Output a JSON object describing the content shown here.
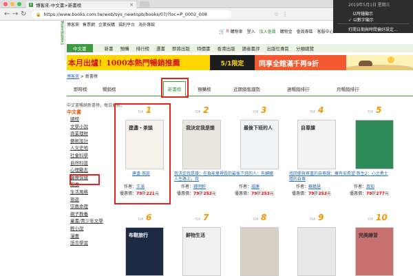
{
  "browser": {
    "tab_title": "博客來-中文書>新書榜",
    "favicon_text": "b",
    "url": "https://www.books.com.tw/web/sys_newtopb/books/07/?loc=P_0002_008",
    "tab_close": "×"
  },
  "menubar_popup": {
    "datetime": "2019年5月1日 星期三",
    "opt1": "以時鐘顯示",
    "opt2": "✓ 以數字顯示",
    "opt3": "打開日期與時間偏好設定..."
  },
  "site": {
    "side_logo": "博客來網路書店",
    "top_links": [
      "博客來",
      "售票網",
      "企業採購",
      "福利平台",
      "海外專館"
    ],
    "cart_count": "0",
    "cart_label": "購物車",
    "login": "登入",
    "join": "加入會員",
    "links": [
      "購物金",
      "會員專區",
      "客服中心"
    ],
    "green_menu": [
      "中文書",
      "新書",
      "預購",
      "排行榜",
      "選書",
      "即將出版",
      "特價書",
      "香港出版",
      "讀者書評",
      "出版社專區",
      "分類總覽"
    ],
    "banner_text": "本月出爐！1000本熱門暢銷推薦",
    "banner_mid": "5/1限定",
    "banner_right": "同享全館滿千再9折",
    "breadcrumb_home": "博客來",
    "breadcrumb_sep": " > ",
    "breadcrumb_current": "新書榜",
    "subnav": [
      "即時榜",
      "暢銷榜",
      "新書榜",
      "預購榜",
      "近期銷售趨勢",
      "週暢銷排行",
      "月暢銷排行"
    ],
    "description": "中文書暢銷新書榜，每日更新。",
    "sidebar_title": "中文書",
    "sidebar": [
      "總榜",
      "文學小說",
      "商業理財",
      "藝術設計",
      "人文史地",
      "社會科學",
      "自然科普",
      "心理勵志",
      "醫療保健",
      "飲食",
      "生活風格",
      "旅遊",
      "宗教命理",
      "親子教養",
      "童書/青少年文學",
      "輕小說",
      "漫畫",
      "語言學習"
    ]
  },
  "products": [
    {
      "rank": "1",
      "title": "建盞‧茶談",
      "author": "王滿",
      "price_label": "優惠價：",
      "discount": "79",
      "discount_unit": "折",
      "price": "221",
      "price_unit": "元",
      "cover_title": "建盞・茶談"
    },
    {
      "rank": "2",
      "title": "我決定我是誰：在負能量裡長的人生路上，我",
      "author": "鍾明軒",
      "price_label": "優惠價：",
      "discount": "79",
      "discount_unit": "折",
      "price": "253",
      "price_unit": "元",
      "cover_title": "我決定我是誰"
    },
    {
      "rank": "3",
      "title": "最後下班的人：先轉職",
      "author": "威廉",
      "price_label": "優惠價：",
      "discount": "79",
      "discount_unit": "折",
      "price": "253",
      "price_unit": "元",
      "cover_title": "最後下班的人"
    },
    {
      "rank": "4",
      "title": "找回愛與尊重的自尊課：擁有安穩的自尊",
      "author": "蘇鶴慧",
      "price_label": "優惠價：",
      "discount": "79",
      "discount_unit": "折",
      "price": "253",
      "price_unit": "元",
      "cover_title": "自尊課"
    },
    {
      "rank": "5",
      "title": "希望‧新生2：心之勇士",
      "author": "真知",
      "price_label": "優惠價：",
      "discount": "79",
      "discount_unit": "折",
      "price": "277",
      "price_unit": "元",
      "cover_title": ""
    },
    {
      "rank": "6",
      "title": "",
      "author": "",
      "cover_title": "布鞋旅行"
    },
    {
      "rank": "7",
      "title": "",
      "author": "",
      "cover_title": "鮮物生活"
    },
    {
      "rank": "8",
      "title": "",
      "author": "",
      "cover_title": ""
    },
    {
      "rank": "9",
      "title": "",
      "author": "",
      "cover_title": ""
    },
    {
      "rank": "10",
      "title": "",
      "author": "",
      "cover_title": "完美練習"
    }
  ],
  "labels": {
    "top": "TOP",
    "author": "作者："
  },
  "colors": {
    "green": "#3c9a3f",
    "orange_rank": "#f39800",
    "highlight_red": "#e3221b",
    "link_blue": "#2c6cb0"
  }
}
